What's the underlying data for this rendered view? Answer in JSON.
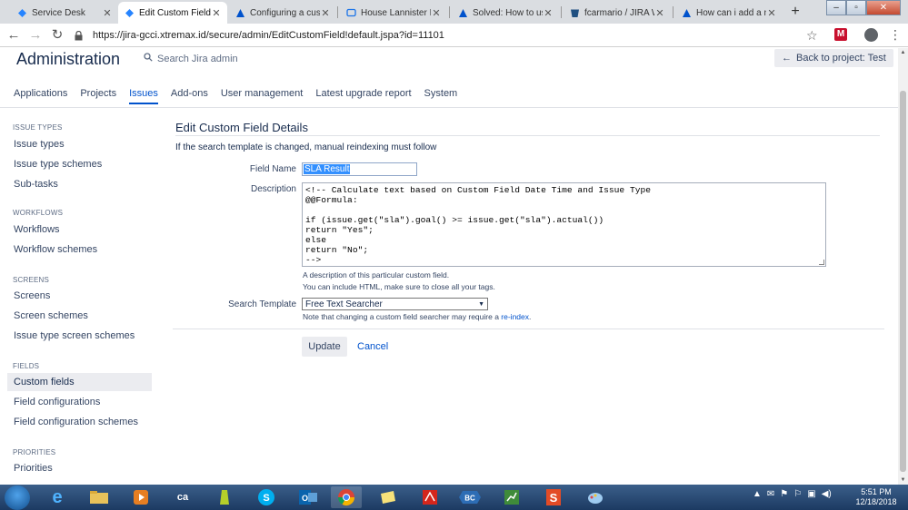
{
  "browser": {
    "tabs": [
      {
        "title": "Service Desk",
        "icon": "jira-icon"
      },
      {
        "title": "Edit Custom Field -",
        "icon": "jira-icon"
      },
      {
        "title": "Configuring a custo",
        "icon": "atlassian-icon"
      },
      {
        "title": "House Lannister Ep",
        "icon": "chat-icon"
      },
      {
        "title": "Solved: How to use",
        "icon": "atlassian-icon"
      },
      {
        "title": "fcarmario / JIRA W",
        "icon": "bitbucket-icon"
      },
      {
        "title": "How can i add a ne",
        "icon": "atlassian-icon"
      }
    ],
    "url": "https://jira-gcci.xtremax.id/secure/admin/EditCustomField!default.jspa?id=11101",
    "extension_label": "M"
  },
  "header": {
    "title": "Administration",
    "search_placeholder": "Search Jira admin",
    "back_button": "Back to project: Test"
  },
  "topnav": [
    "Applications",
    "Projects",
    "Issues",
    "Add-ons",
    "User management",
    "Latest upgrade report",
    "System"
  ],
  "sidebar": {
    "sections": [
      {
        "heading": "ISSUE TYPES",
        "items": [
          "Issue types",
          "Issue type schemes",
          "Sub-tasks"
        ]
      },
      {
        "heading": "WORKFLOWS",
        "items": [
          "Workflows",
          "Workflow schemes"
        ]
      },
      {
        "heading": "SCREENS",
        "items": [
          "Screens",
          "Screen schemes",
          "Issue type screen schemes"
        ]
      },
      {
        "heading": "FIELDS",
        "items": [
          "Custom fields",
          "Field configurations",
          "Field configuration schemes"
        ]
      },
      {
        "heading": "PRIORITIES",
        "items": [
          "Priorities"
        ]
      }
    ]
  },
  "form": {
    "title": "Edit Custom Field Details",
    "reindex_note": "If the search template is changed, manual reindexing must follow",
    "field_name_label": "Field Name",
    "field_name_value": "SLA Result",
    "description_label": "Description",
    "description_value": "<!-- Calculate text based on Custom Field Date Time and Issue Type\n@@Formula:\n\nif (issue.get(\"sla\").goal() >= issue.get(\"sla\").actual())\nreturn \"Yes\";\nelse\nreturn \"No\";\n-->",
    "description_help_1": "A description of this particular custom field.",
    "description_help_2": "You can include HTML, make sure to close all your tags.",
    "search_template_label": "Search Template",
    "search_template_value": "Free Text Searcher",
    "searcher_note_prefix": "Note that changing a custom field searcher may require a",
    "searcher_note_link": "re-index",
    "searcher_note_suffix": ".",
    "update_button": "Update",
    "cancel_link": "Cancel"
  },
  "taskbar": {
    "clock_time": "5:51 PM",
    "clock_date": "12/18/2018"
  }
}
